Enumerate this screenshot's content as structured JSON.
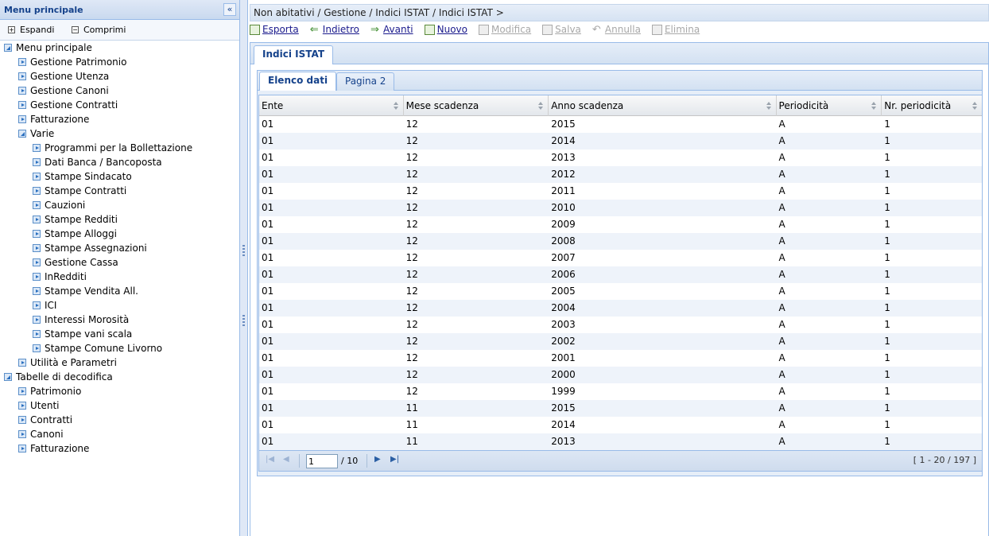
{
  "left_panel": {
    "title": "Menu principale",
    "collapse_glyph": "«",
    "toolbar": {
      "expand_label": "Espandi",
      "collapse_label": "Comprimi"
    },
    "tree": [
      {
        "label": "Menu principale",
        "level": 0,
        "icon": "open"
      },
      {
        "label": "Gestione Patrimonio",
        "level": 1,
        "icon": "leaf"
      },
      {
        "label": "Gestione Utenza",
        "level": 1,
        "icon": "leaf"
      },
      {
        "label": "Gestione Canoni",
        "level": 1,
        "icon": "leaf"
      },
      {
        "label": "Gestione Contratti",
        "level": 1,
        "icon": "leaf"
      },
      {
        "label": "Fatturazione",
        "level": 1,
        "icon": "leaf"
      },
      {
        "label": "Varie",
        "level": 1,
        "icon": "open"
      },
      {
        "label": "Programmi per la Bollettazione",
        "level": 2,
        "icon": "leaf"
      },
      {
        "label": "Dati Banca / Bancoposta",
        "level": 2,
        "icon": "leaf"
      },
      {
        "label": "Stampe Sindacato",
        "level": 2,
        "icon": "leaf"
      },
      {
        "label": "Stampe Contratti",
        "level": 2,
        "icon": "leaf"
      },
      {
        "label": "Cauzioni",
        "level": 2,
        "icon": "leaf"
      },
      {
        "label": "Stampe Redditi",
        "level": 2,
        "icon": "leaf"
      },
      {
        "label": "Stampe Alloggi",
        "level": 2,
        "icon": "leaf"
      },
      {
        "label": "Stampe Assegnazioni",
        "level": 2,
        "icon": "leaf"
      },
      {
        "label": "Gestione Cassa",
        "level": 2,
        "icon": "leaf"
      },
      {
        "label": "InRedditi",
        "level": 2,
        "icon": "leaf"
      },
      {
        "label": "Stampe Vendita All.",
        "level": 2,
        "icon": "leaf"
      },
      {
        "label": "ICI",
        "level": 2,
        "icon": "leaf"
      },
      {
        "label": "Interessi Morosità",
        "level": 2,
        "icon": "leaf"
      },
      {
        "label": "Stampe vani scala",
        "level": 2,
        "icon": "leaf"
      },
      {
        "label": "Stampe Comune Livorno",
        "level": 2,
        "icon": "leaf"
      },
      {
        "label": "Utilità e Parametri",
        "level": 1,
        "icon": "leaf"
      },
      {
        "label": "Tabelle di decodifica",
        "level": 0,
        "icon": "open"
      },
      {
        "label": "Patrimonio",
        "level": 1,
        "icon": "leaf"
      },
      {
        "label": "Utenti",
        "level": 1,
        "icon": "leaf"
      },
      {
        "label": "Contratti",
        "level": 1,
        "icon": "leaf"
      },
      {
        "label": "Canoni",
        "level": 1,
        "icon": "leaf"
      },
      {
        "label": "Fatturazione",
        "level": 1,
        "icon": "leaf"
      }
    ]
  },
  "breadcrumb": "Non abitativi / Gestione / Indici ISTAT / Indici ISTAT >",
  "actions": [
    {
      "label": "Esporta",
      "enabled": true,
      "icon": "excel-icon"
    },
    {
      "label": "Indietro",
      "enabled": true,
      "icon": "back-arrow-icon"
    },
    {
      "label": "Avanti",
      "enabled": true,
      "icon": "forward-arrow-icon"
    },
    {
      "label": "Nuovo",
      "enabled": true,
      "icon": "new-document-icon"
    },
    {
      "label": "Modifica",
      "enabled": false,
      "icon": "edit-icon"
    },
    {
      "label": "Salva",
      "enabled": false,
      "icon": "save-icon"
    },
    {
      "label": "Annulla",
      "enabled": false,
      "icon": "undo-icon"
    },
    {
      "label": "Elimina",
      "enabled": false,
      "icon": "delete-icon"
    }
  ],
  "outer_tab": "Indici ISTAT",
  "inner_tabs": [
    "Elenco dati",
    "Pagina 2"
  ],
  "grid": {
    "columns": [
      "Ente",
      "Mese scadenza",
      "Anno scadenza",
      "Periodicità",
      "Nr. periodicità"
    ],
    "rows": [
      [
        "01",
        "12",
        "2015",
        "A",
        "1"
      ],
      [
        "01",
        "12",
        "2014",
        "A",
        "1"
      ],
      [
        "01",
        "12",
        "2013",
        "A",
        "1"
      ],
      [
        "01",
        "12",
        "2012",
        "A",
        "1"
      ],
      [
        "01",
        "12",
        "2011",
        "A",
        "1"
      ],
      [
        "01",
        "12",
        "2010",
        "A",
        "1"
      ],
      [
        "01",
        "12",
        "2009",
        "A",
        "1"
      ],
      [
        "01",
        "12",
        "2008",
        "A",
        "1"
      ],
      [
        "01",
        "12",
        "2007",
        "A",
        "1"
      ],
      [
        "01",
        "12",
        "2006",
        "A",
        "1"
      ],
      [
        "01",
        "12",
        "2005",
        "A",
        "1"
      ],
      [
        "01",
        "12",
        "2004",
        "A",
        "1"
      ],
      [
        "01",
        "12",
        "2003",
        "A",
        "1"
      ],
      [
        "01",
        "12",
        "2002",
        "A",
        "1"
      ],
      [
        "01",
        "12",
        "2001",
        "A",
        "1"
      ],
      [
        "01",
        "12",
        "2000",
        "A",
        "1"
      ],
      [
        "01",
        "12",
        "1999",
        "A",
        "1"
      ],
      [
        "01",
        "11",
        "2015",
        "A",
        "1"
      ],
      [
        "01",
        "11",
        "2014",
        "A",
        "1"
      ],
      [
        "01",
        "11",
        "2013",
        "A",
        "1"
      ]
    ]
  },
  "pager": {
    "current_page": "1",
    "of_pages": "/ 10",
    "info": "[ 1 - 20 / 197 ]"
  }
}
